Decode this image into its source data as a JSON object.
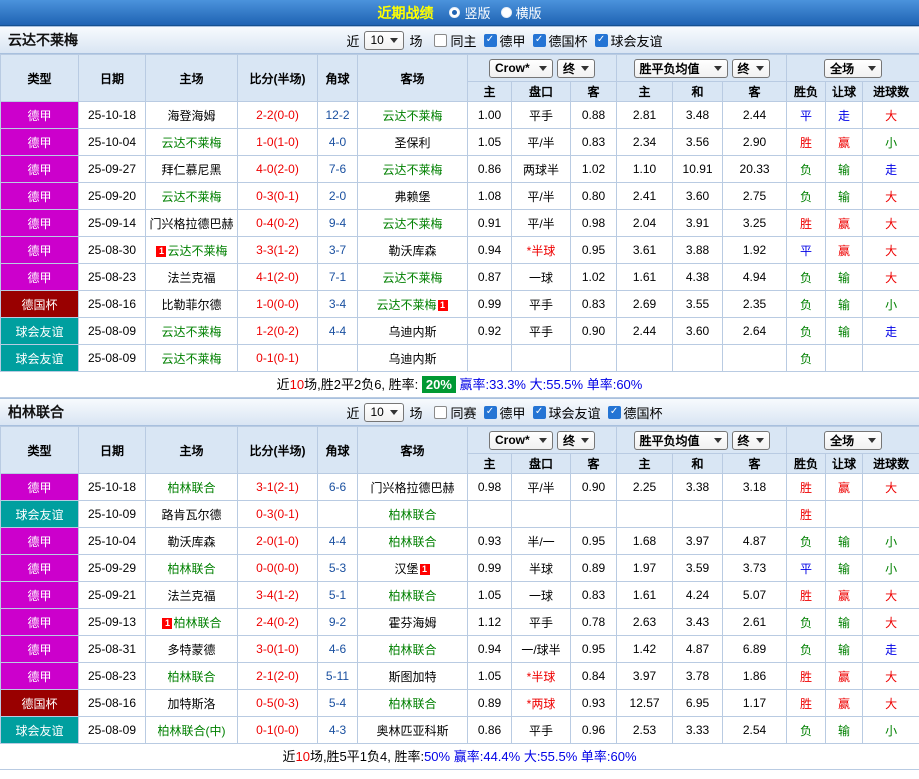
{
  "topbar": {
    "title": "近期战绩",
    "radios": [
      {
        "label": "竖版",
        "selected": true
      },
      {
        "label": "横版",
        "selected": false
      }
    ]
  },
  "filter_labels": {
    "near": "近",
    "games": "场"
  },
  "table_header": {
    "type": "类型",
    "date": "日期",
    "home": "主场",
    "score": "比分(半场)",
    "corner": "角球",
    "away": "客场",
    "odds_company": "Crow*",
    "odds_final": "终",
    "avg_label": "胜平负均值",
    "avg_final": "终",
    "scope": "全场",
    "sub_home": "主",
    "sub_handicap": "盘口",
    "sub_away": "客",
    "sub_home2": "主",
    "sub_draw": "和",
    "sub_away2": "客",
    "result": "胜负",
    "handicap_result": "让球",
    "goals": "进球数"
  },
  "colors": {
    "league_jia": "#cc00cc",
    "league_cup": "#990000",
    "league_friendly": "#009f9f",
    "win_red": "#ee0000",
    "lose_green": "#008000",
    "draw_blue": "#0000e6",
    "team_green": "#008000",
    "score_red": "#ee0000",
    "badge_green_bg": "#009933",
    "topbar_title_yellow": "#ffff00"
  },
  "sections": [
    {
      "team": "云达不莱梅",
      "filter": {
        "count": "10",
        "checkboxes": [
          {
            "label": "同主",
            "checked": false
          },
          {
            "label": "德甲",
            "checked": true
          },
          {
            "label": "德国杯",
            "checked": true
          },
          {
            "label": "球会友谊",
            "checked": true
          }
        ]
      },
      "rows": [
        {
          "league": "德甲",
          "cls": "jia",
          "date": "25-10-18",
          "home": "海登海姆",
          "home_green": false,
          "score": "2-2(0-0)",
          "corner": "12-2",
          "away": "云达不莱梅",
          "away_green": true,
          "o1": "1.00",
          "o2": "平手",
          "o3": "0.88",
          "e1": "2.81",
          "e2": "3.48",
          "e3": "2.44",
          "r1": "平",
          "r2": "走",
          "r3": "大"
        },
        {
          "league": "德甲",
          "cls": "jia",
          "date": "25-10-04",
          "home": "云达不莱梅",
          "home_green": true,
          "score": "1-0(1-0)",
          "corner": "4-0",
          "away": "圣保利",
          "away_green": false,
          "o1": "1.05",
          "o2": "平/半",
          "o3": "0.83",
          "e1": "2.34",
          "e2": "3.56",
          "e3": "2.90",
          "r1": "胜",
          "r2": "赢",
          "r3": "小"
        },
        {
          "league": "德甲",
          "cls": "jia",
          "date": "25-09-27",
          "home": "拜仁慕尼黑",
          "home_green": false,
          "score": "4-0(2-0)",
          "corner": "7-6",
          "away": "云达不莱梅",
          "away_green": true,
          "o1": "0.86",
          "o2": "两球半",
          "o3": "1.02",
          "e1": "1.10",
          "e2": "10.91",
          "e3": "20.33",
          "r1": "负",
          "r2": "输",
          "r3": "走"
        },
        {
          "league": "德甲",
          "cls": "jia",
          "date": "25-09-20",
          "home": "云达不莱梅",
          "home_green": true,
          "score": "0-3(0-1)",
          "corner": "2-0",
          "away": "弗赖堡",
          "away_green": false,
          "o1": "1.08",
          "o2": "平/半",
          "o3": "0.80",
          "e1": "2.41",
          "e2": "3.60",
          "e3": "2.75",
          "r1": "负",
          "r2": "输",
          "r3": "大"
        },
        {
          "league": "德甲",
          "cls": "jia",
          "date": "25-09-14",
          "home": "门兴格拉德巴赫",
          "home_green": false,
          "score": "0-4(0-2)",
          "corner": "9-4",
          "away": "云达不莱梅",
          "away_green": true,
          "o1": "0.91",
          "o2": "平/半",
          "o3": "0.98",
          "e1": "2.04",
          "e2": "3.91",
          "e3": "3.25",
          "r1": "胜",
          "r2": "赢",
          "r3": "大"
        },
        {
          "league": "德甲",
          "cls": "jia",
          "date": "25-08-30",
          "home": "云达不莱梅",
          "home_green": true,
          "home_pre": "1",
          "score": "3-3(1-2)",
          "corner": "3-7",
          "away": "勒沃库森",
          "away_green": false,
          "o1": "0.94",
          "o2": "*半球",
          "o3": "0.95",
          "e1": "3.61",
          "e2": "3.88",
          "e3": "1.92",
          "r1": "平",
          "r2": "赢",
          "r3": "大"
        },
        {
          "league": "德甲",
          "cls": "jia",
          "date": "25-08-23",
          "home": "法兰克福",
          "home_green": false,
          "score": "4-1(2-0)",
          "corner": "7-1",
          "away": "云达不莱梅",
          "away_green": true,
          "o1": "0.87",
          "o2": "一球",
          "o3": "1.02",
          "e1": "1.61",
          "e2": "4.38",
          "e3": "4.94",
          "r1": "负",
          "r2": "输",
          "r3": "大"
        },
        {
          "league": "德国杯",
          "cls": "cup",
          "date": "25-08-16",
          "home": "比勒菲尔德",
          "home_green": false,
          "score": "1-0(0-0)",
          "corner": "3-4",
          "away": "云达不莱梅",
          "away_green": true,
          "away_post": "1",
          "o1": "0.99",
          "o2": "平手",
          "o3": "0.83",
          "e1": "2.69",
          "e2": "3.55",
          "e3": "2.35",
          "r1": "负",
          "r2": "输",
          "r3": "小"
        },
        {
          "league": "球会友谊",
          "cls": "fri",
          "date": "25-08-09",
          "home": "云达不莱梅",
          "home_green": true,
          "score": "1-2(0-2)",
          "corner": "4-4",
          "away": "乌迪内斯",
          "away_green": false,
          "o1": "0.92",
          "o2": "平手",
          "o3": "0.90",
          "e1": "2.44",
          "e2": "3.60",
          "e3": "2.64",
          "r1": "负",
          "r2": "输",
          "r3": "走"
        },
        {
          "league": "球会友谊",
          "cls": "fri",
          "date": "25-08-09",
          "home": "云达不莱梅",
          "home_green": true,
          "score": "0-1(0-1)",
          "corner": "",
          "away": "乌迪内斯",
          "away_green": false,
          "o1": "",
          "o2": "",
          "o3": "",
          "e1": "",
          "e2": "",
          "e3": "",
          "r1": "负",
          "r2": "",
          "r3": ""
        }
      ],
      "summary": [
        {
          "t": "近",
          "c": "k"
        },
        {
          "t": "10",
          "c": "r"
        },
        {
          "t": "场,胜2平2负6, 胜率: ",
          "c": "k"
        },
        {
          "t": "20%",
          "c": "badge"
        },
        {
          "t": " 赢率:33.3%",
          "c": "b"
        },
        {
          "t": " 大:55.5%",
          "c": "b"
        },
        {
          "t": " 单率:60%",
          "c": "b"
        }
      ]
    },
    {
      "team": "柏林联合",
      "filter": {
        "count": "10",
        "checkboxes": [
          {
            "label": "同赛",
            "checked": false
          },
          {
            "label": "德甲",
            "checked": true
          },
          {
            "label": "球会友谊",
            "checked": true
          },
          {
            "label": "德国杯",
            "checked": true
          }
        ]
      },
      "rows": [
        {
          "league": "德甲",
          "cls": "jia",
          "date": "25-10-18",
          "home": "柏林联合",
          "home_green": true,
          "score": "3-1(2-1)",
          "corner": "6-6",
          "away": "门兴格拉德巴赫",
          "away_green": false,
          "o1": "0.98",
          "o2": "平/半",
          "o3": "0.90",
          "e1": "2.25",
          "e2": "3.38",
          "e3": "3.18",
          "r1": "胜",
          "r2": "赢",
          "r3": "大"
        },
        {
          "league": "球会友谊",
          "cls": "fri",
          "date": "25-10-09",
          "home": "路肯瓦尔德",
          "home_green": false,
          "score": "0-3(0-1)",
          "corner": "",
          "away": "柏林联合",
          "away_green": true,
          "o1": "",
          "o2": "",
          "o3": "",
          "e1": "",
          "e2": "",
          "e3": "",
          "r1": "胜",
          "r2": "",
          "r3": ""
        },
        {
          "league": "德甲",
          "cls": "jia",
          "date": "25-10-04",
          "home": "勒沃库森",
          "home_green": false,
          "score": "2-0(1-0)",
          "corner": "4-4",
          "away": "柏林联合",
          "away_green": true,
          "o1": "0.93",
          "o2": "半/一",
          "o3": "0.95",
          "e1": "1.68",
          "e2": "3.97",
          "e3": "4.87",
          "r1": "负",
          "r2": "输",
          "r3": "小"
        },
        {
          "league": "德甲",
          "cls": "jia",
          "date": "25-09-29",
          "home": "柏林联合",
          "home_green": true,
          "score": "0-0(0-0)",
          "corner": "5-3",
          "away": "汉堡",
          "away_green": false,
          "away_post": "1",
          "o1": "0.99",
          "o2": "半球",
          "o3": "0.89",
          "e1": "1.97",
          "e2": "3.59",
          "e3": "3.73",
          "r1": "平",
          "r2": "输",
          "r3": "小"
        },
        {
          "league": "德甲",
          "cls": "jia",
          "date": "25-09-21",
          "home": "法兰克福",
          "home_green": false,
          "score": "3-4(1-2)",
          "corner": "5-1",
          "away": "柏林联合",
          "away_green": true,
          "o1": "1.05",
          "o2": "一球",
          "o3": "0.83",
          "e1": "1.61",
          "e2": "4.24",
          "e3": "5.07",
          "r1": "胜",
          "r2": "赢",
          "r3": "大"
        },
        {
          "league": "德甲",
          "cls": "jia",
          "date": "25-09-13",
          "home": "柏林联合",
          "home_green": true,
          "home_pre": "1",
          "score": "2-4(0-2)",
          "corner": "9-2",
          "away": "霍芬海姆",
          "away_green": false,
          "o1": "1.12",
          "o2": "平手",
          "o3": "0.78",
          "e1": "2.63",
          "e2": "3.43",
          "e3": "2.61",
          "r1": "负",
          "r2": "输",
          "r3": "大"
        },
        {
          "league": "德甲",
          "cls": "jia",
          "date": "25-08-31",
          "home": "多特蒙德",
          "home_green": false,
          "score": "3-0(1-0)",
          "corner": "4-6",
          "away": "柏林联合",
          "away_green": true,
          "o1": "0.94",
          "o2": "一/球半",
          "o3": "0.95",
          "e1": "1.42",
          "e2": "4.87",
          "e3": "6.89",
          "r1": "负",
          "r2": "输",
          "r3": "走"
        },
        {
          "league": "德甲",
          "cls": "jia",
          "date": "25-08-23",
          "home": "柏林联合",
          "home_green": true,
          "score": "2-1(2-0)",
          "corner": "5-11",
          "away": "斯图加特",
          "away_green": false,
          "o1": "1.05",
          "o2": "*半球",
          "o3": "0.84",
          "e1": "3.97",
          "e2": "3.78",
          "e3": "1.86",
          "r1": "胜",
          "r2": "赢",
          "r3": "大"
        },
        {
          "league": "德国杯",
          "cls": "cup",
          "date": "25-08-16",
          "home": "加特斯洛",
          "home_green": false,
          "score": "0-5(0-3)",
          "corner": "5-4",
          "away": "柏林联合",
          "away_green": true,
          "o1": "0.89",
          "o2": "*两球",
          "o3": "0.93",
          "e1": "12.57",
          "e2": "6.95",
          "e3": "1.17",
          "r1": "胜",
          "r2": "赢",
          "r3": "大"
        },
        {
          "league": "球会友谊",
          "cls": "fri",
          "date": "25-08-09",
          "home": "柏林联合(中)",
          "home_green": true,
          "score": "0-1(0-0)",
          "corner": "4-3",
          "away": "奥林匹亚科斯",
          "away_green": false,
          "o1": "0.86",
          "o2": "平手",
          "o3": "0.96",
          "e1": "2.53",
          "e2": "3.33",
          "e3": "2.54",
          "r1": "负",
          "r2": "输",
          "r3": "小"
        }
      ],
      "summary": [
        {
          "t": "近",
          "c": "k"
        },
        {
          "t": "10",
          "c": "r"
        },
        {
          "t": "场,胜5平1负4, 胜率:",
          "c": "k"
        },
        {
          "t": "50%",
          "c": "b"
        },
        {
          "t": " 赢率:44.4%",
          "c": "b"
        },
        {
          "t": " 大:55.5%",
          "c": "b"
        },
        {
          "t": " 单率:60%",
          "c": "b"
        }
      ]
    }
  ]
}
